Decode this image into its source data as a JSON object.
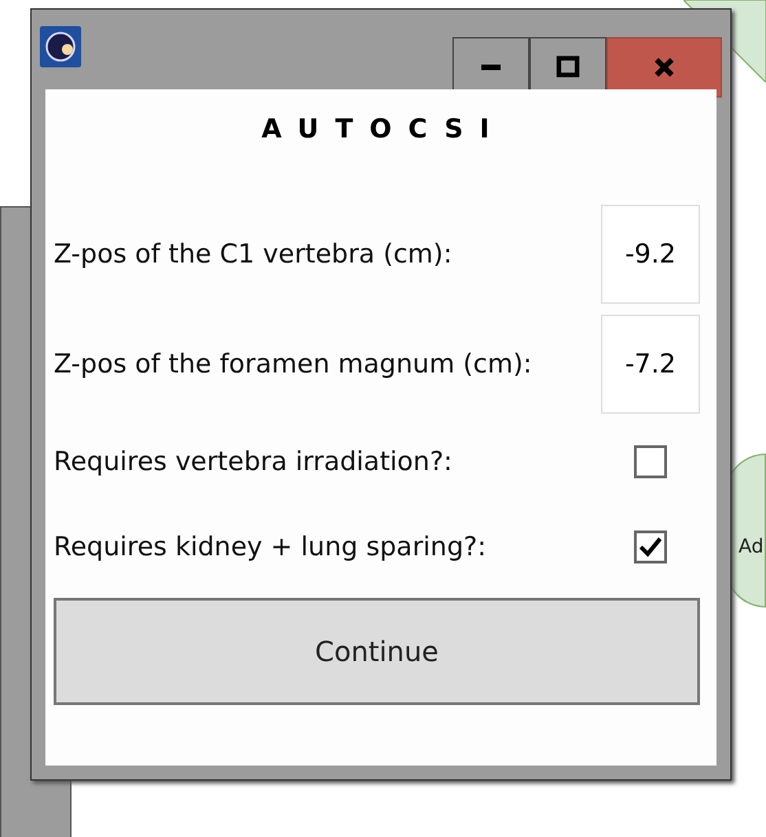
{
  "window": {
    "title": "AUTOCSI"
  },
  "fields": [
    {
      "label": "Z-pos of the C1 vertebra (cm):",
      "value": "-9.2"
    },
    {
      "label": "Z-pos of the foramen magnum (cm):",
      "value": "-7.2"
    }
  ],
  "options": [
    {
      "label": "Requires vertebra irradiation?:",
      "checked": false
    },
    {
      "label": "Requires kidney + lung sparing?:",
      "checked": true
    }
  ],
  "buttons": [
    "Continue"
  ],
  "background": {
    "node_label": "Ad"
  }
}
